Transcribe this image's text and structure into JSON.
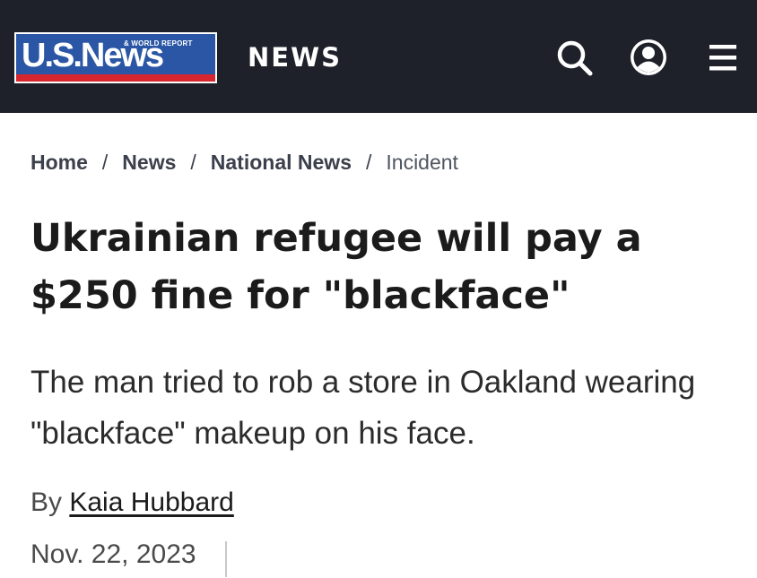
{
  "header": {
    "logo": {
      "main_text": "U.S.News",
      "sub_text": "& WORLD REPORT",
      "colors": {
        "blue": "#2a56a5",
        "red": "#d7262e"
      }
    },
    "section": "NEWS",
    "icons": [
      "search-icon",
      "account-icon",
      "menu-icon"
    ],
    "background": "#1e202a"
  },
  "breadcrumb": {
    "items": [
      {
        "label": "Home"
      },
      {
        "label": "News"
      },
      {
        "label": "National News"
      }
    ],
    "separator": "/",
    "current": "Incident"
  },
  "article": {
    "headline_line1": "Ukrainian refugee will pay a",
    "headline_line2": "$250 fine for \"blackface\"",
    "dek_line1": "The man tried to rob a store in Oakland wearing",
    "dek_line2": "\"blackface\" makeup on his face.",
    "byline_prefix": "By",
    "author": "Kaia Hubbard",
    "date": "Nov. 22, 2023"
  }
}
